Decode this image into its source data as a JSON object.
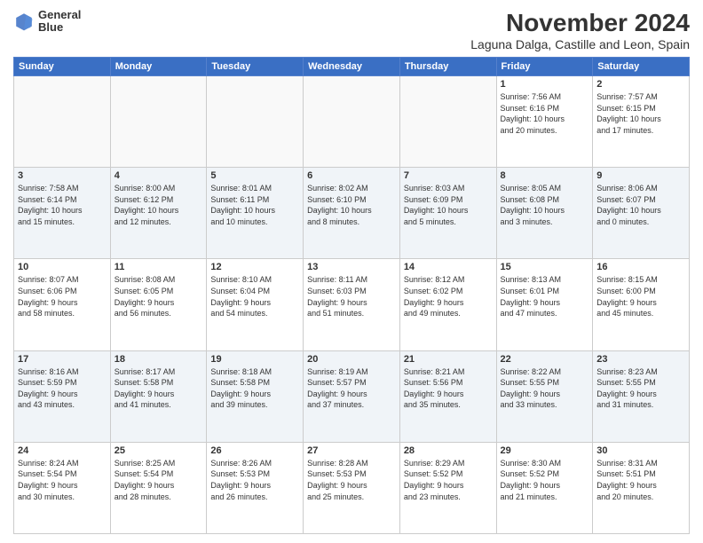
{
  "header": {
    "logo_line1": "General",
    "logo_line2": "Blue",
    "main_title": "November 2024",
    "subtitle": "Laguna Dalga, Castille and Leon, Spain"
  },
  "weekdays": [
    "Sunday",
    "Monday",
    "Tuesday",
    "Wednesday",
    "Thursday",
    "Friday",
    "Saturday"
  ],
  "weeks": [
    [
      {
        "day": "",
        "info": ""
      },
      {
        "day": "",
        "info": ""
      },
      {
        "day": "",
        "info": ""
      },
      {
        "day": "",
        "info": ""
      },
      {
        "day": "",
        "info": ""
      },
      {
        "day": "1",
        "info": "Sunrise: 7:56 AM\nSunset: 6:16 PM\nDaylight: 10 hours\nand 20 minutes."
      },
      {
        "day": "2",
        "info": "Sunrise: 7:57 AM\nSunset: 6:15 PM\nDaylight: 10 hours\nand 17 minutes."
      }
    ],
    [
      {
        "day": "3",
        "info": "Sunrise: 7:58 AM\nSunset: 6:14 PM\nDaylight: 10 hours\nand 15 minutes."
      },
      {
        "day": "4",
        "info": "Sunrise: 8:00 AM\nSunset: 6:12 PM\nDaylight: 10 hours\nand 12 minutes."
      },
      {
        "day": "5",
        "info": "Sunrise: 8:01 AM\nSunset: 6:11 PM\nDaylight: 10 hours\nand 10 minutes."
      },
      {
        "day": "6",
        "info": "Sunrise: 8:02 AM\nSunset: 6:10 PM\nDaylight: 10 hours\nand 8 minutes."
      },
      {
        "day": "7",
        "info": "Sunrise: 8:03 AM\nSunset: 6:09 PM\nDaylight: 10 hours\nand 5 minutes."
      },
      {
        "day": "8",
        "info": "Sunrise: 8:05 AM\nSunset: 6:08 PM\nDaylight: 10 hours\nand 3 minutes."
      },
      {
        "day": "9",
        "info": "Sunrise: 8:06 AM\nSunset: 6:07 PM\nDaylight: 10 hours\nand 0 minutes."
      }
    ],
    [
      {
        "day": "10",
        "info": "Sunrise: 8:07 AM\nSunset: 6:06 PM\nDaylight: 9 hours\nand 58 minutes."
      },
      {
        "day": "11",
        "info": "Sunrise: 8:08 AM\nSunset: 6:05 PM\nDaylight: 9 hours\nand 56 minutes."
      },
      {
        "day": "12",
        "info": "Sunrise: 8:10 AM\nSunset: 6:04 PM\nDaylight: 9 hours\nand 54 minutes."
      },
      {
        "day": "13",
        "info": "Sunrise: 8:11 AM\nSunset: 6:03 PM\nDaylight: 9 hours\nand 51 minutes."
      },
      {
        "day": "14",
        "info": "Sunrise: 8:12 AM\nSunset: 6:02 PM\nDaylight: 9 hours\nand 49 minutes."
      },
      {
        "day": "15",
        "info": "Sunrise: 8:13 AM\nSunset: 6:01 PM\nDaylight: 9 hours\nand 47 minutes."
      },
      {
        "day": "16",
        "info": "Sunrise: 8:15 AM\nSunset: 6:00 PM\nDaylight: 9 hours\nand 45 minutes."
      }
    ],
    [
      {
        "day": "17",
        "info": "Sunrise: 8:16 AM\nSunset: 5:59 PM\nDaylight: 9 hours\nand 43 minutes."
      },
      {
        "day": "18",
        "info": "Sunrise: 8:17 AM\nSunset: 5:58 PM\nDaylight: 9 hours\nand 41 minutes."
      },
      {
        "day": "19",
        "info": "Sunrise: 8:18 AM\nSunset: 5:58 PM\nDaylight: 9 hours\nand 39 minutes."
      },
      {
        "day": "20",
        "info": "Sunrise: 8:19 AM\nSunset: 5:57 PM\nDaylight: 9 hours\nand 37 minutes."
      },
      {
        "day": "21",
        "info": "Sunrise: 8:21 AM\nSunset: 5:56 PM\nDaylight: 9 hours\nand 35 minutes."
      },
      {
        "day": "22",
        "info": "Sunrise: 8:22 AM\nSunset: 5:55 PM\nDaylight: 9 hours\nand 33 minutes."
      },
      {
        "day": "23",
        "info": "Sunrise: 8:23 AM\nSunset: 5:55 PM\nDaylight: 9 hours\nand 31 minutes."
      }
    ],
    [
      {
        "day": "24",
        "info": "Sunrise: 8:24 AM\nSunset: 5:54 PM\nDaylight: 9 hours\nand 30 minutes."
      },
      {
        "day": "25",
        "info": "Sunrise: 8:25 AM\nSunset: 5:54 PM\nDaylight: 9 hours\nand 28 minutes."
      },
      {
        "day": "26",
        "info": "Sunrise: 8:26 AM\nSunset: 5:53 PM\nDaylight: 9 hours\nand 26 minutes."
      },
      {
        "day": "27",
        "info": "Sunrise: 8:28 AM\nSunset: 5:53 PM\nDaylight: 9 hours\nand 25 minutes."
      },
      {
        "day": "28",
        "info": "Sunrise: 8:29 AM\nSunset: 5:52 PM\nDaylight: 9 hours\nand 23 minutes."
      },
      {
        "day": "29",
        "info": "Sunrise: 8:30 AM\nSunset: 5:52 PM\nDaylight: 9 hours\nand 21 minutes."
      },
      {
        "day": "30",
        "info": "Sunrise: 8:31 AM\nSunset: 5:51 PM\nDaylight: 9 hours\nand 20 minutes."
      }
    ]
  ]
}
